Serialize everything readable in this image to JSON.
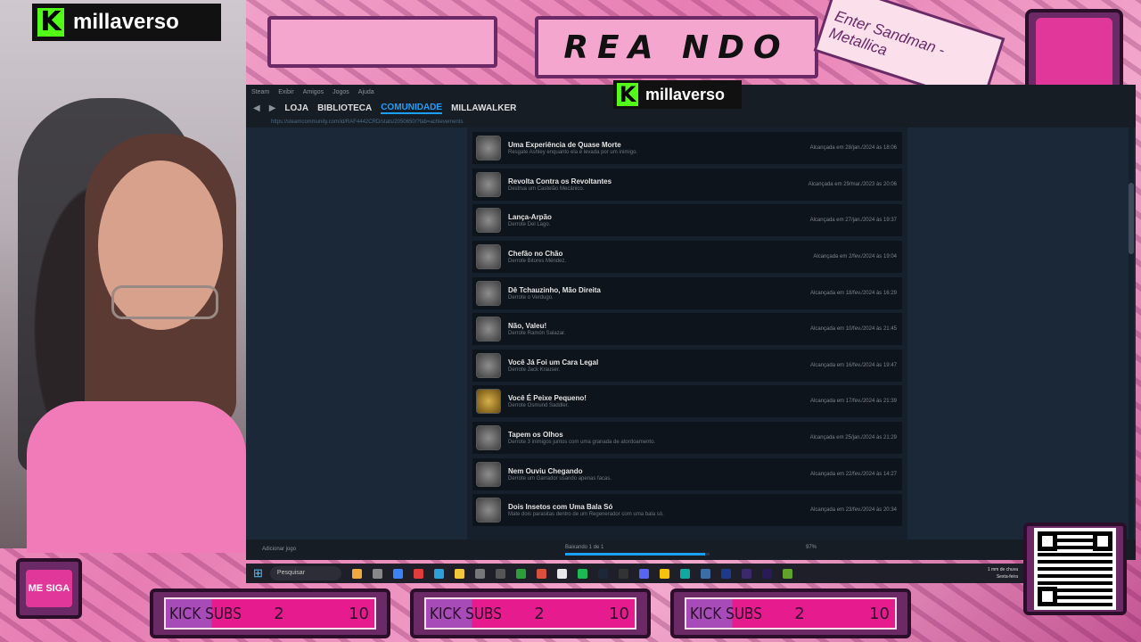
{
  "overlay": {
    "brand_name": "millaverso",
    "brand_logo_letter": "K",
    "reagindo": "REA   NDO",
    "song": "Enter Sandman - Metallica",
    "follow_label": "ME SIGA",
    "sub_counters": [
      {
        "label": "KICK SUBS",
        "current": "2",
        "goal": "10"
      },
      {
        "label": "KICK SUBS",
        "current": "2",
        "goal": "10"
      },
      {
        "label": "KICK SUBS",
        "current": "2",
        "goal": "10"
      }
    ],
    "colors": {
      "accent": "#e2379a",
      "frame": "#6b2a66",
      "kick_green": "#53fc18"
    }
  },
  "steam": {
    "menu": [
      "Steam",
      "Exibir",
      "Amigos",
      "Jogos",
      "Ajuda"
    ],
    "nav": [
      {
        "label": "LOJA",
        "active": false
      },
      {
        "label": "BIBLIOTECA",
        "active": false
      },
      {
        "label": "COMUNIDADE",
        "active": true
      },
      {
        "label": "MILLAWALKER",
        "active": false
      }
    ],
    "url": "https://steamcommunity.com/id/RAF4442CRD/stats/2050650/?tab=achievements",
    "achievements": [
      {
        "title": "Uma Experiência de Quase Morte",
        "desc": "Resgate Ashley enquanto ela é levada por um inimigo.",
        "date": "Alcançada em 28/jan./2024 às 18:06",
        "gold": false
      },
      {
        "title": "Revolta Contra os Revoltantes",
        "desc": "Destrua um Castelão Mecânico.",
        "date": "Alcançada em 29/mar./2023 às 20:06",
        "gold": false
      },
      {
        "title": "Lança-Arpão",
        "desc": "Derrote Del Lago.",
        "date": "Alcançada em 27/jan./2024 às 19:37",
        "gold": false
      },
      {
        "title": "Chefão no Chão",
        "desc": "Derrote Bitores Méndez.",
        "date": "Alcançada em 2/fev./2024 às 19:04",
        "gold": false
      },
      {
        "title": "Dê Tchauzinho, Mão Direita",
        "desc": "Derrote o Verdugo.",
        "date": "Alcançada em 18/fev./2024 às 16:29",
        "gold": false
      },
      {
        "title": "Não, Valeu!",
        "desc": "Derrote Ramón Salazar.",
        "date": "Alcançada em 10/fev./2024 às 21:45",
        "gold": false
      },
      {
        "title": "Você Já Foi um Cara Legal",
        "desc": "Derrote Jack Krauser.",
        "date": "Alcançada em 16/fev./2024 às 19:47",
        "gold": false
      },
      {
        "title": "Você É Peixe Pequeno!",
        "desc": "Derrote Osmund Saddler.",
        "date": "Alcançada em 17/fev./2024 às 21:39",
        "gold": true
      },
      {
        "title": "Tapem os Olhos",
        "desc": "Derrote 3 inimigos juntos com uma granada de atordoamento.",
        "date": "Alcançada em 25/jan./2024 às 21:29",
        "gold": false
      },
      {
        "title": "Nem Ouviu Chegando",
        "desc": "Derrote um Garrador usando apenas facas.",
        "date": "Alcançada em 22/fev./2024 às 14:27",
        "gold": false
      },
      {
        "title": "Dois Insetos com Uma Bala Só",
        "desc": "Mate dois parasitas dentro de um Regenerador com uma bala só.",
        "date": "Alcançada em 23/fev./2024 às 20:34",
        "gold": false
      }
    ],
    "footer": {
      "add_game": "Adicionar jogo",
      "download": "Baixando 1 de 1",
      "progress_pct": 0.97,
      "progress_label": "97%"
    }
  },
  "taskbar": {
    "search_placeholder": "Pesquisar",
    "weather_line1": "1 mm de chuva",
    "weather_line2": "Sexta-feira"
  }
}
